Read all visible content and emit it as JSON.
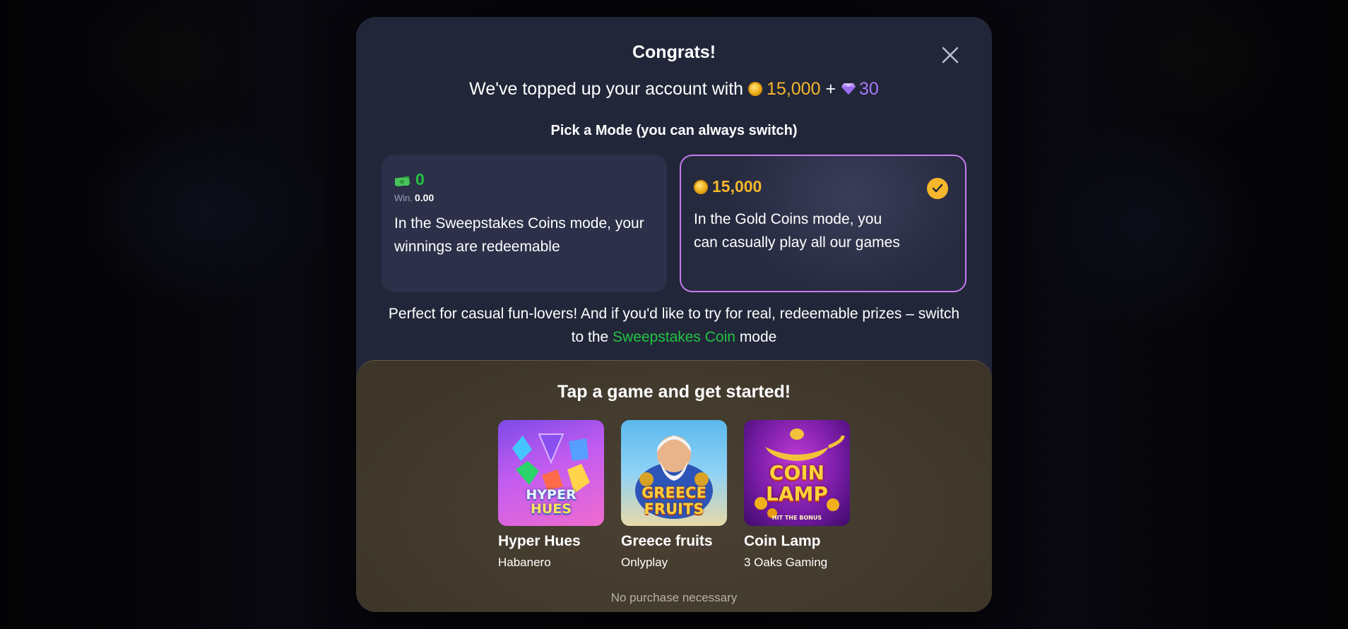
{
  "modal": {
    "title": "Congrats!",
    "topup_text": "We've topped up your account with",
    "gold_amount": "15,000",
    "plus": "+",
    "gem_amount": "30",
    "pick_title": "Pick a Mode (you can always switch)"
  },
  "modes": {
    "sweepstakes": {
      "amount": "0",
      "win_label": "Win.",
      "win_value": "0.00",
      "description": "In the Sweepstakes Coins mode, your winnings are redeemable",
      "selected": false
    },
    "gold": {
      "amount": "15,000",
      "description": "In the Gold Coins mode, you can casually play all our games",
      "selected": true
    }
  },
  "info": {
    "text_before": "Perfect for casual fun-lovers! And if you'd like to try for real, redeemable prizes – switch to the",
    "highlight": "Sweepstakes Coin",
    "text_after": "mode"
  },
  "games_section": {
    "title": "Tap a game and get started!",
    "games": [
      {
        "name": "Hyper Hues",
        "provider": "Habanero",
        "art_text_1": "HYPER",
        "art_text_2": "HUES"
      },
      {
        "name": "Greece fruits",
        "provider": "Onlyplay",
        "art_text_1": "GREECE",
        "art_text_2": "FRUITS"
      },
      {
        "name": "Coin Lamp",
        "provider": "3 Oaks Gaming",
        "art_text_1": "COIN",
        "art_text_2": "LAMP",
        "art_text_3": "HIT THE BONUS"
      }
    ],
    "footer": "No purchase necessary"
  },
  "colors": {
    "gold": "#f5b72b",
    "gem": "#a97af7",
    "sweeps_green": "#20c441",
    "selected_border": "#c77cf0",
    "modal_bg": "#222639"
  },
  "icons": [
    "close-icon",
    "gold-coin-icon",
    "gem-icon",
    "cash-icon",
    "check-icon"
  ]
}
